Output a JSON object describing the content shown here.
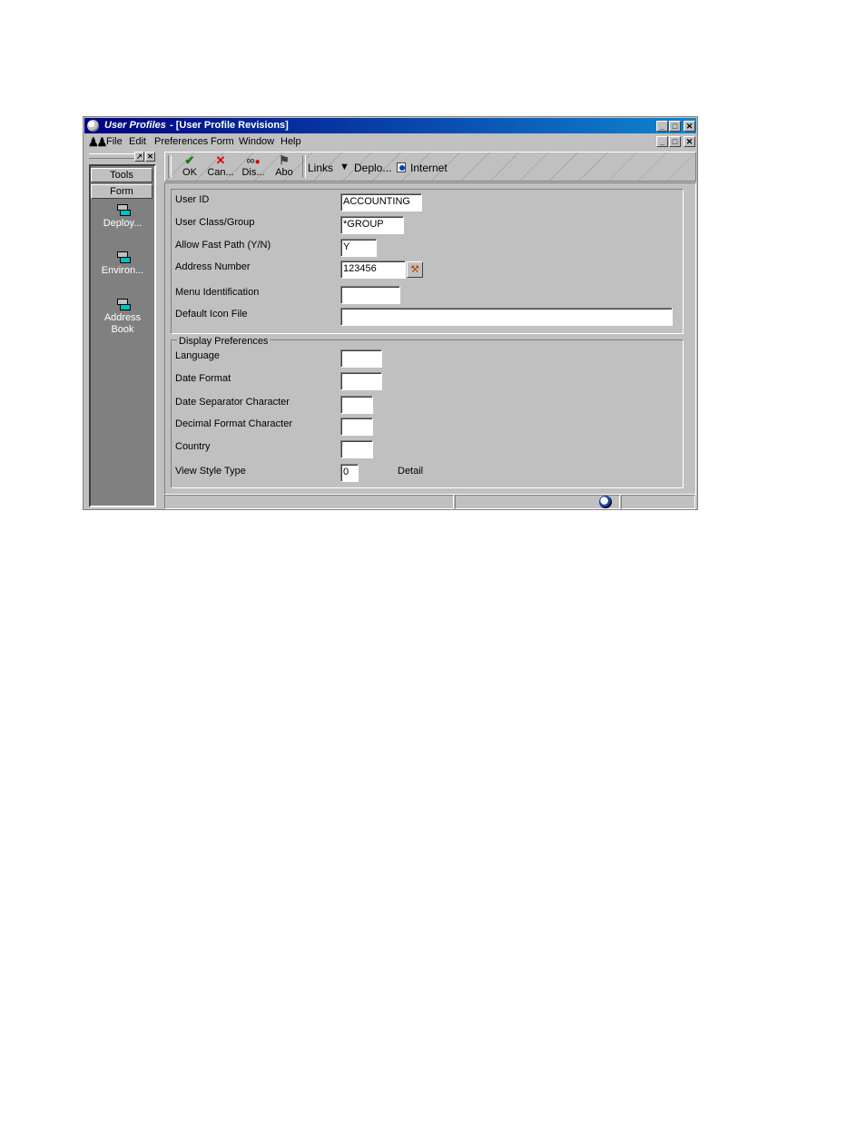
{
  "window": {
    "app_title": "User Profiles",
    "doc_title": "- [User Profile Revisions]",
    "controls": {
      "minimize": "_",
      "maximize": "□",
      "close": "✕",
      "restore": "🗗"
    }
  },
  "menu": [
    "File",
    "Edit",
    "Preferences",
    "Form",
    "Window",
    "Help"
  ],
  "sidebar": {
    "buttons": [
      "Tools",
      "Form"
    ],
    "items": [
      {
        "label": "Deploy..."
      },
      {
        "label": "Environ..."
      },
      {
        "label": "Address Book"
      }
    ]
  },
  "toolbar": {
    "ok": "OK",
    "cancel": "Can...",
    "display": "Dis...",
    "about": "Abo",
    "links": "Links",
    "deploy": "Deplo...",
    "internet": "Internet"
  },
  "form": {
    "user_id": {
      "label": "User ID",
      "value": "ACCOUNTING"
    },
    "user_class": {
      "label": "User Class/Group",
      "value": "*GROUP"
    },
    "fast_path": {
      "label": "Allow Fast Path (Y/N)",
      "value": "Y"
    },
    "address_number": {
      "label": "Address Number",
      "value": "123456"
    },
    "menu_id": {
      "label": "Menu Identification",
      "value": ""
    },
    "icon_file": {
      "label": "Default Icon File",
      "value": ""
    },
    "display_prefs": {
      "title": "Display Preferences",
      "language": {
        "label": "Language",
        "value": ""
      },
      "date_format": {
        "label": "Date Format",
        "value": ""
      },
      "date_sep": {
        "label": "Date Separator Character",
        "value": ""
      },
      "decimal_format": {
        "label": "Decimal Format Character",
        "value": ""
      },
      "country": {
        "label": "Country",
        "value": ""
      },
      "view_style": {
        "label": "View Style Type",
        "value": "0",
        "description": "Detail"
      }
    }
  }
}
